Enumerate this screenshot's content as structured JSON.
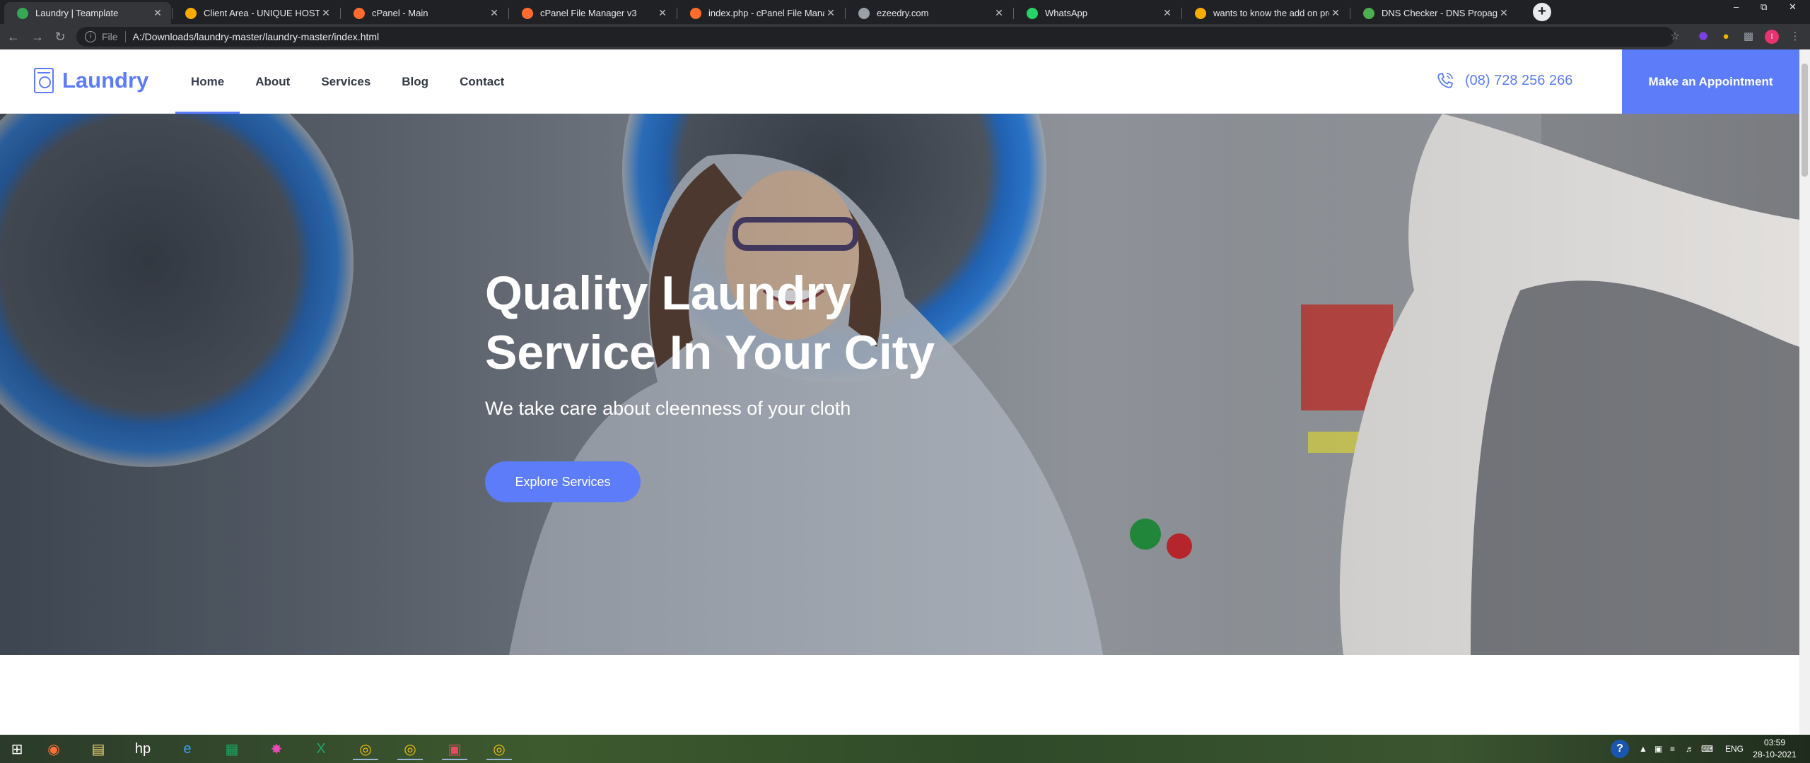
{
  "browser": {
    "tabs": [
      {
        "title": "Laundry | Teamplate",
        "favicon": "laundry-favicon",
        "color": "#34a853",
        "active": true
      },
      {
        "title": "Client Area - UNIQUE HOSTING I",
        "favicon": "hosting-favicon",
        "color": "#f9ab00",
        "active": false
      },
      {
        "title": "cPanel - Main",
        "favicon": "cpanel-favicon",
        "color": "#ff6c2c",
        "active": false
      },
      {
        "title": "cPanel File Manager v3",
        "favicon": "cpanel-favicon",
        "color": "#ff6c2c",
        "active": false
      },
      {
        "title": "index.php - cPanel File Manager",
        "favicon": "cpanel-favicon",
        "color": "#ff6c2c",
        "active": false
      },
      {
        "title": "ezeedry.com",
        "favicon": "globe-favicon",
        "color": "#9aa0a6",
        "active": false
      },
      {
        "title": "WhatsApp",
        "favicon": "whatsapp-favicon",
        "color": "#25d366",
        "active": false
      },
      {
        "title": "wants to know the add on proce",
        "favicon": "hosting-favicon",
        "color": "#f9ab00",
        "active": false
      },
      {
        "title": "DNS Checker - DNS Propagation",
        "favicon": "dns-favicon",
        "color": "#4caf50",
        "active": false
      }
    ],
    "address": {
      "scheme_label": "File",
      "url": "A:/Downloads/laundry-master/laundry-master/index.html"
    },
    "profile_initial": "I"
  },
  "site": {
    "logo_text": "Laundry",
    "nav": [
      {
        "label": "Home",
        "active": true
      },
      {
        "label": "About",
        "active": false
      },
      {
        "label": "Services",
        "active": false
      },
      {
        "label": "Blog",
        "active": false
      },
      {
        "label": "Contact",
        "active": false
      }
    ],
    "phone": "(08) 728 256 266",
    "cta_label": "Make an Appointment",
    "brand_color": "#5c7cfa"
  },
  "hero": {
    "title_line1": "Quality Laundry",
    "title_line2": "Service In Your City",
    "subtitle": "We take care about cleenness of your cloth",
    "button_label": "Explore Services"
  },
  "taskbar": {
    "apps": [
      "start-icon",
      "firefox-icon",
      "file-explorer-icon",
      "hp-icon",
      "internet-explorer-icon",
      "sheets-icon",
      "paint-icon",
      "excel-icon",
      "chrome-icon",
      "chrome-icon",
      "media-icon",
      "chrome-icon"
    ],
    "language": "ENG",
    "time": "03:59",
    "date": "28-10-2021"
  }
}
